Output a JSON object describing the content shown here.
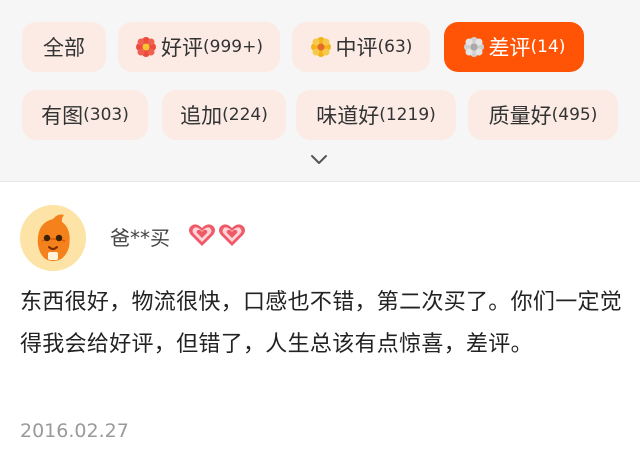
{
  "filters": {
    "row1": [
      {
        "label": "全部",
        "count": "",
        "icon": "",
        "active": false
      },
      {
        "label": "好评",
        "count": "(999+)",
        "icon": "red-flower-icon",
        "active": false
      },
      {
        "label": "中评",
        "count": "(63)",
        "icon": "yellow-flower-icon",
        "active": false
      },
      {
        "label": "差评",
        "count": "(14)",
        "icon": "gray-flower-icon",
        "active": true
      }
    ],
    "row2": [
      {
        "label": "有图",
        "count": "(303)"
      },
      {
        "label": "追加",
        "count": "(224)"
      },
      {
        "label": "味道好",
        "count": "(1219)"
      },
      {
        "label": "质量好",
        "count": "(495)"
      }
    ],
    "expand_icon": "chevron-down-icon"
  },
  "review": {
    "username": "爸**买",
    "badge_icons": [
      "heart-icon",
      "heart-icon"
    ],
    "text": "东西很好，物流很快，口感也不错，第二次买了。你们一定觉得我会给好评，但错了，人生总该有点惊喜，差评。",
    "date": "2016.02.27"
  },
  "colors": {
    "accent": "#ff5405",
    "chip_bg": "#fbebe4",
    "page_bg": "#f6f6f6"
  }
}
